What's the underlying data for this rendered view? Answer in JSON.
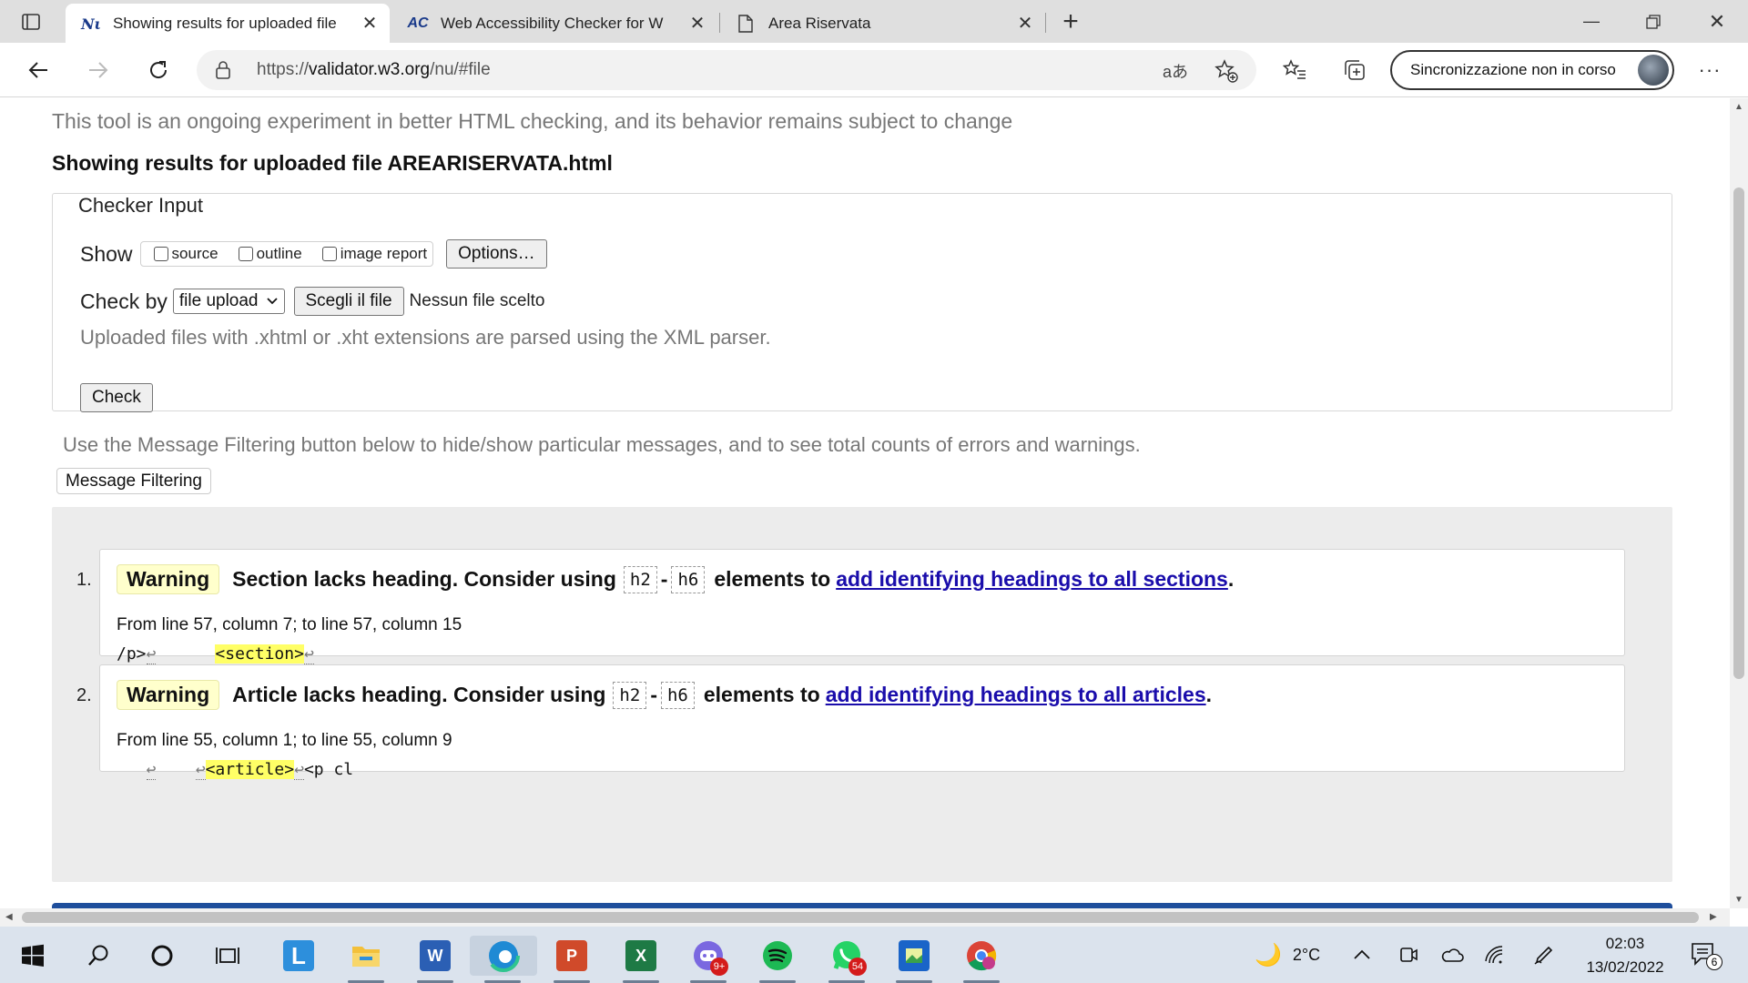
{
  "browser": {
    "tabs": [
      {
        "title": "Showing results for uploaded file",
        "favicon": "Nu",
        "active": true
      },
      {
        "title": "Web Accessibility Checker for W",
        "favicon": "AC",
        "active": false
      },
      {
        "title": "Area Riservata",
        "favicon": "page",
        "active": false
      }
    ],
    "url_prefix": "https://",
    "url_host": "validator.w3.org",
    "url_path": "/nu/#file",
    "profile_label": "Sincronizzazione non in corso",
    "read_aloud_glyph": "aあ"
  },
  "page": {
    "intro": "This tool is an ongoing experiment in better HTML checking, and its behavior remains subject to change",
    "results_title": "Showing results for uploaded file AREARISERVATA.html",
    "checker_legend": "Checker Input",
    "show_label": "Show",
    "show_options": [
      "source",
      "outline",
      "image report"
    ],
    "options_button": "Options…",
    "check_by_label": "Check by",
    "check_by_value": "file upload",
    "choose_file_button": "Scegli il file",
    "no_file_text": "Nessun file scelto",
    "xml_note": "Uploaded files with .xhtml or .xht extensions are parsed using the XML parser.",
    "check_button": "Check",
    "filter_note": "Use the Message Filtering button below to hide/show particular messages, and to see total counts of errors and warnings.",
    "filter_button": "Message Filtering"
  },
  "messages": [
    {
      "num": "1.",
      "type": "Warning",
      "text": "Section lacks heading. Consider using",
      "code_a": "h2",
      "dash": "-",
      "code_b": "h6",
      "text2": "elements to",
      "link": "add identifying headings to all sections",
      "period": ".",
      "location": "From line 57, column 7; to line 57, column 15",
      "extract_pre": "/p>",
      "extract_mid": "      ",
      "extract_hl": "<section>",
      "extract_post": ""
    },
    {
      "num": "2.",
      "type": "Warning",
      "text": "Article lacks heading. Consider using",
      "code_a": "h2",
      "dash": "-",
      "code_b": "h6",
      "text2": "elements to",
      "link": "add identifying headings to all articles",
      "period": ".",
      "location": "From line 55, column 1; to line 55, column 9",
      "extract_pre": "   ",
      "extract_mid": "    ",
      "extract_hl": "<article>",
      "extract_post": "<p cl"
    }
  ],
  "taskbar": {
    "weather_temp": "2°C",
    "time": "02:03",
    "date": "13/02/2022",
    "notification_count": "6",
    "whatsapp_badge": "54",
    "discord_badge": "9+"
  },
  "colors": {
    "warning_bg": "#ffffcc",
    "link": "#1a0dab",
    "highlight": "#ffff66",
    "results_bg": "#ececec"
  }
}
